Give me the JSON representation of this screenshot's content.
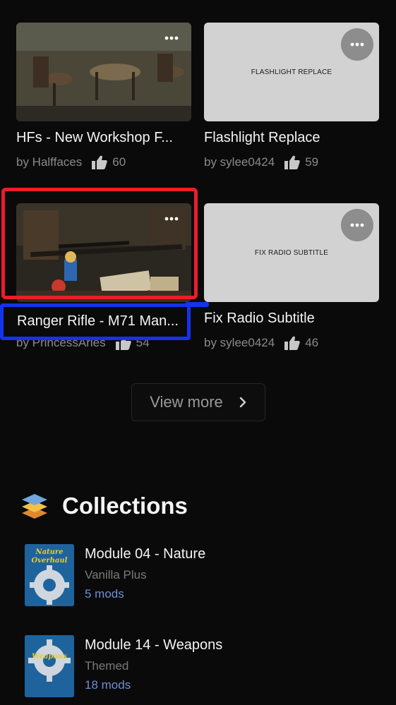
{
  "mods": [
    {
      "title": "HFs - New Workshop F...",
      "author": "by Halffaces",
      "likes": "60",
      "thumb_label": ""
    },
    {
      "title": "Flashlight Replace",
      "author": "by sylee0424",
      "likes": "59",
      "thumb_label": "FLASHLIGHT REPLACE"
    },
    {
      "title": "Ranger Rifle - M71 Man...",
      "author": "by PrincessAries",
      "likes": "54",
      "thumb_label": ""
    },
    {
      "title": "Fix Radio Subtitle",
      "author": "by sylee0424",
      "likes": "46",
      "thumb_label": "FIX RADIO SUBTITLE"
    }
  ],
  "view_more_label": "View more",
  "collections_section": {
    "title": "Collections",
    "items": [
      {
        "name": "Module 04 - Nature",
        "category": "Vanilla Plus",
        "count": "5 mods",
        "badge": "Nature Overhaul"
      },
      {
        "name": "Module 14 - Weapons",
        "category": "Themed",
        "count": "18 mods",
        "badge": "Weapons"
      }
    ]
  },
  "icons": {
    "more": "more-options-icon",
    "like": "thumbs-up-icon",
    "chevron": "chevron-right-icon",
    "collections": "stacked-layers-icon",
    "gear": "gear-icon"
  },
  "colors": {
    "background": "#0a0a0b",
    "placeholder_thumb": "#d2d2d2",
    "mod_count_link": "#6e8fd1",
    "annotation_red": "#ee1c2a",
    "annotation_blue": "#1234ee"
  }
}
